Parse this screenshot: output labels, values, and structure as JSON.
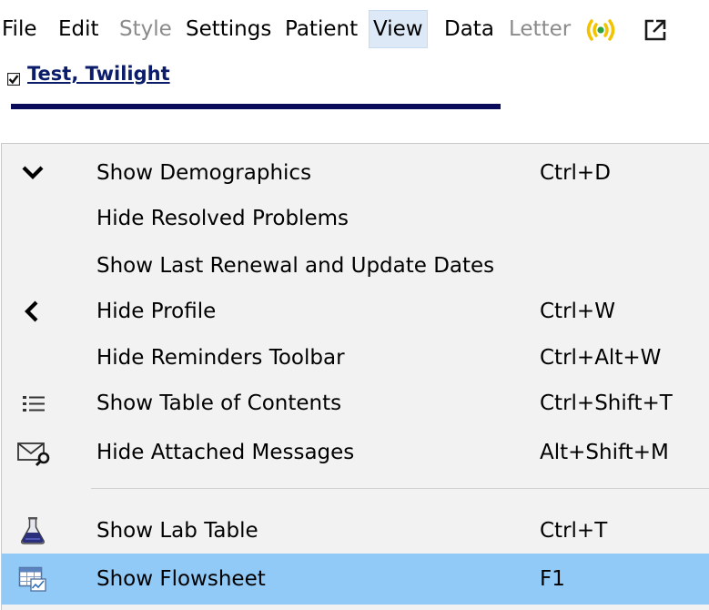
{
  "menubar": {
    "items": [
      {
        "label": "File",
        "enabled": true
      },
      {
        "label": "Edit",
        "enabled": true
      },
      {
        "label": "Style",
        "enabled": false
      },
      {
        "label": "Settings",
        "enabled": true
      },
      {
        "label": "Patient",
        "enabled": true
      },
      {
        "label": "View",
        "enabled": true,
        "active": true
      },
      {
        "label": "Data",
        "enabled": true
      },
      {
        "label": "Letter",
        "enabled": false
      }
    ],
    "icons": [
      "broadcast-signal-icon",
      "popout-external-icon"
    ]
  },
  "patient": {
    "name": "Test, Twilight",
    "checked": true
  },
  "view_menu": {
    "items": [
      {
        "label": "Show Demographics",
        "shortcut": "Ctrl+D",
        "icon": "chevron-down-icon"
      },
      {
        "label": "Hide Resolved Problems",
        "shortcut": ""
      },
      {
        "label": "Show Last Renewal and Update Dates",
        "shortcut": ""
      },
      {
        "label": "Hide Profile",
        "shortcut": "Ctrl+W",
        "icon": "chevron-left-icon"
      },
      {
        "label": "Hide Reminders Toolbar",
        "shortcut": "Ctrl+Alt+W"
      },
      {
        "label": "Show Table of Contents",
        "shortcut": "Ctrl+Shift+T",
        "icon": "list-icon"
      },
      {
        "label": "Hide Attached Messages",
        "shortcut": "Alt+Shift+M",
        "icon": "envelope-search-icon"
      },
      {
        "label": "Show Lab Table",
        "shortcut": "Ctrl+T",
        "icon": "flask-icon"
      },
      {
        "label": "Show Flowsheet",
        "shortcut": "F1",
        "icon": "flowsheet-icon",
        "highlighted": true
      }
    ]
  },
  "colors": {
    "menu_background": "#f2f2f2",
    "highlight": "#91c9f7",
    "active_menu": "#dde9f7",
    "patient_name": "#0a1c6a",
    "patient_bar": "#0b0b5c",
    "disabled_text": "#8a8a8a"
  }
}
